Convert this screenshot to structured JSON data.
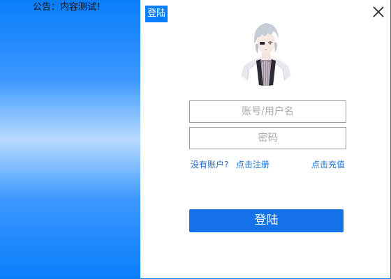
{
  "notice": {
    "text": "公告：内容测试！"
  },
  "header": {
    "title": "登陆",
    "close_icon": "close-icon"
  },
  "avatar": {
    "icon": "avatar-illustration"
  },
  "form": {
    "account_placeholder": "账号/用户名",
    "account_value": "",
    "password_placeholder": "密码",
    "password_value": ""
  },
  "links": {
    "no_account": "没有账户?",
    "register": "点击注册",
    "recharge": "点击充值"
  },
  "login_button": {
    "label": "登陆"
  },
  "colors": {
    "accent": "#0a7dfb",
    "button": "#1472e8",
    "link": "#1a73d6"
  }
}
